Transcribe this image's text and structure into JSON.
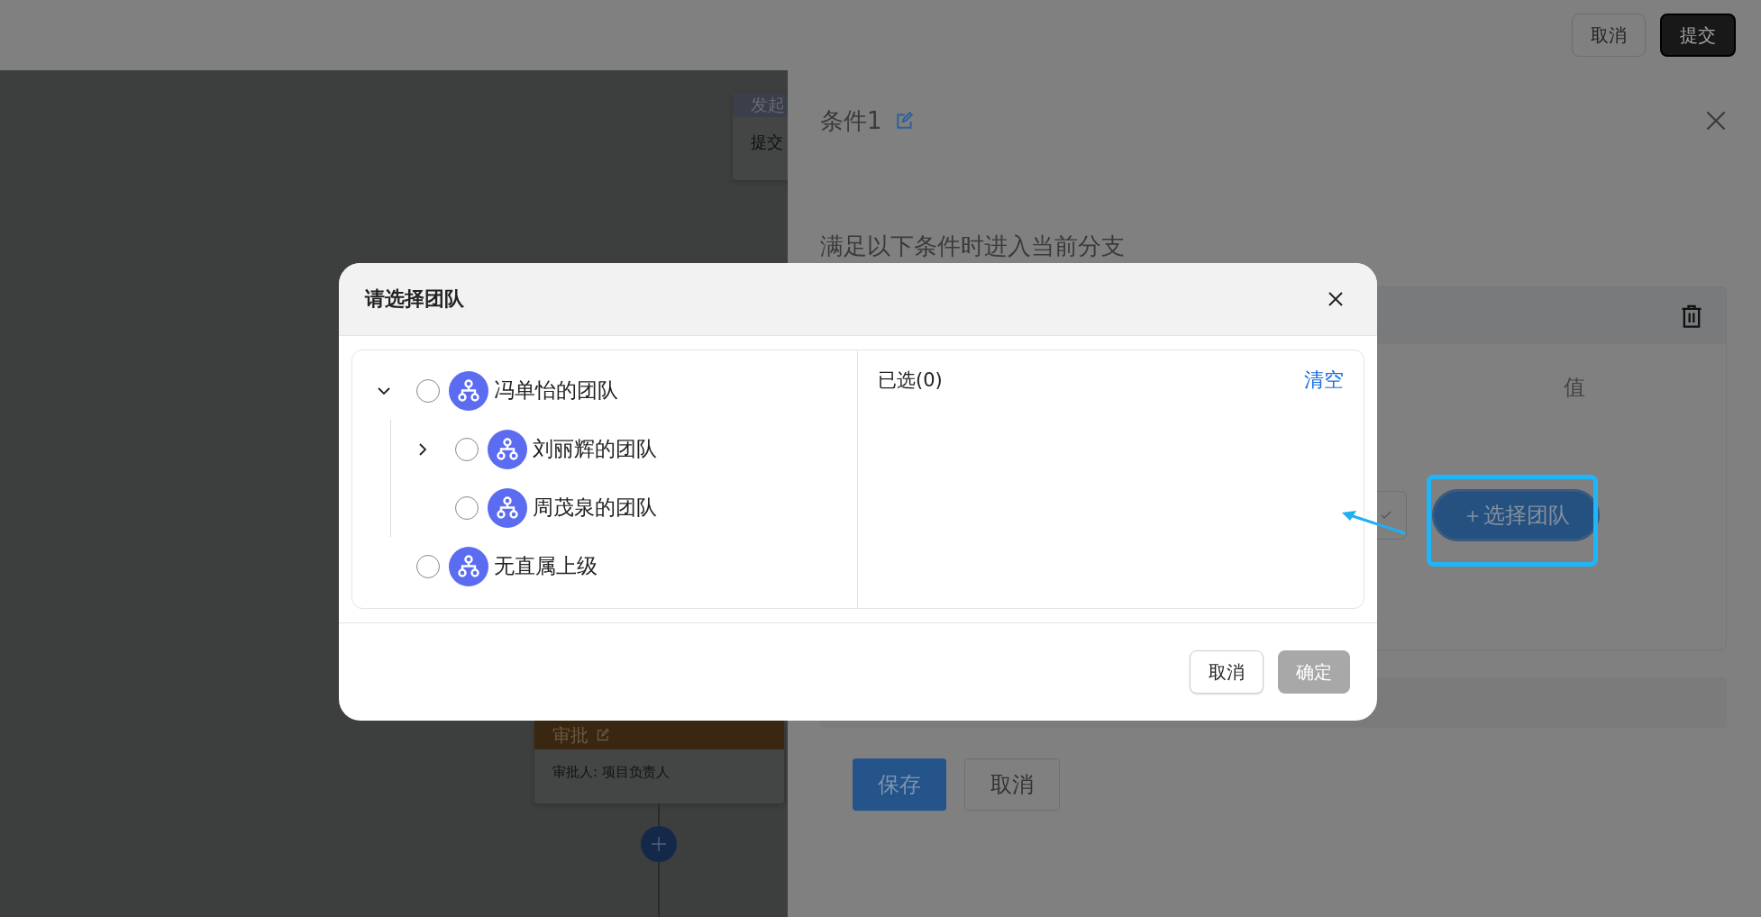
{
  "top_bar": {
    "buttons": [
      {
        "label": "取消",
        "kind": "default"
      },
      {
        "label": "提交",
        "kind": "primary"
      }
    ]
  },
  "canvas": {
    "start_node": {
      "title": "发起",
      "body": "提交"
    },
    "approval_node": {
      "title": "审批",
      "body": "审批人: 项目负责人"
    }
  },
  "panel": {
    "title": "条件1",
    "subtitle": "满足以下条件时进入当前分支",
    "condition": {
      "column": "值",
      "select_button": "＋选择团队"
    },
    "buttons": [
      {
        "label": "保存",
        "kind": "primary"
      },
      {
        "label": "取消",
        "kind": "default"
      }
    ]
  },
  "dialog": {
    "title": "请选择团队",
    "tree": [
      {
        "label": "冯单怡的团队",
        "selected": false,
        "expanded": true,
        "children": [
          {
            "label": "刘丽辉的团队",
            "selected": false,
            "expanded": false
          },
          {
            "label": "周茂泉的团队",
            "selected": false
          }
        ]
      },
      {
        "label": "无直属上级",
        "selected": false
      }
    ],
    "selected_label": "已选(0)",
    "clear_link": "清空",
    "buttons": [
      {
        "label": "取消",
        "kind": "default",
        "disabled": false
      },
      {
        "label": "确定",
        "kind": "primary",
        "disabled": true
      }
    ]
  }
}
